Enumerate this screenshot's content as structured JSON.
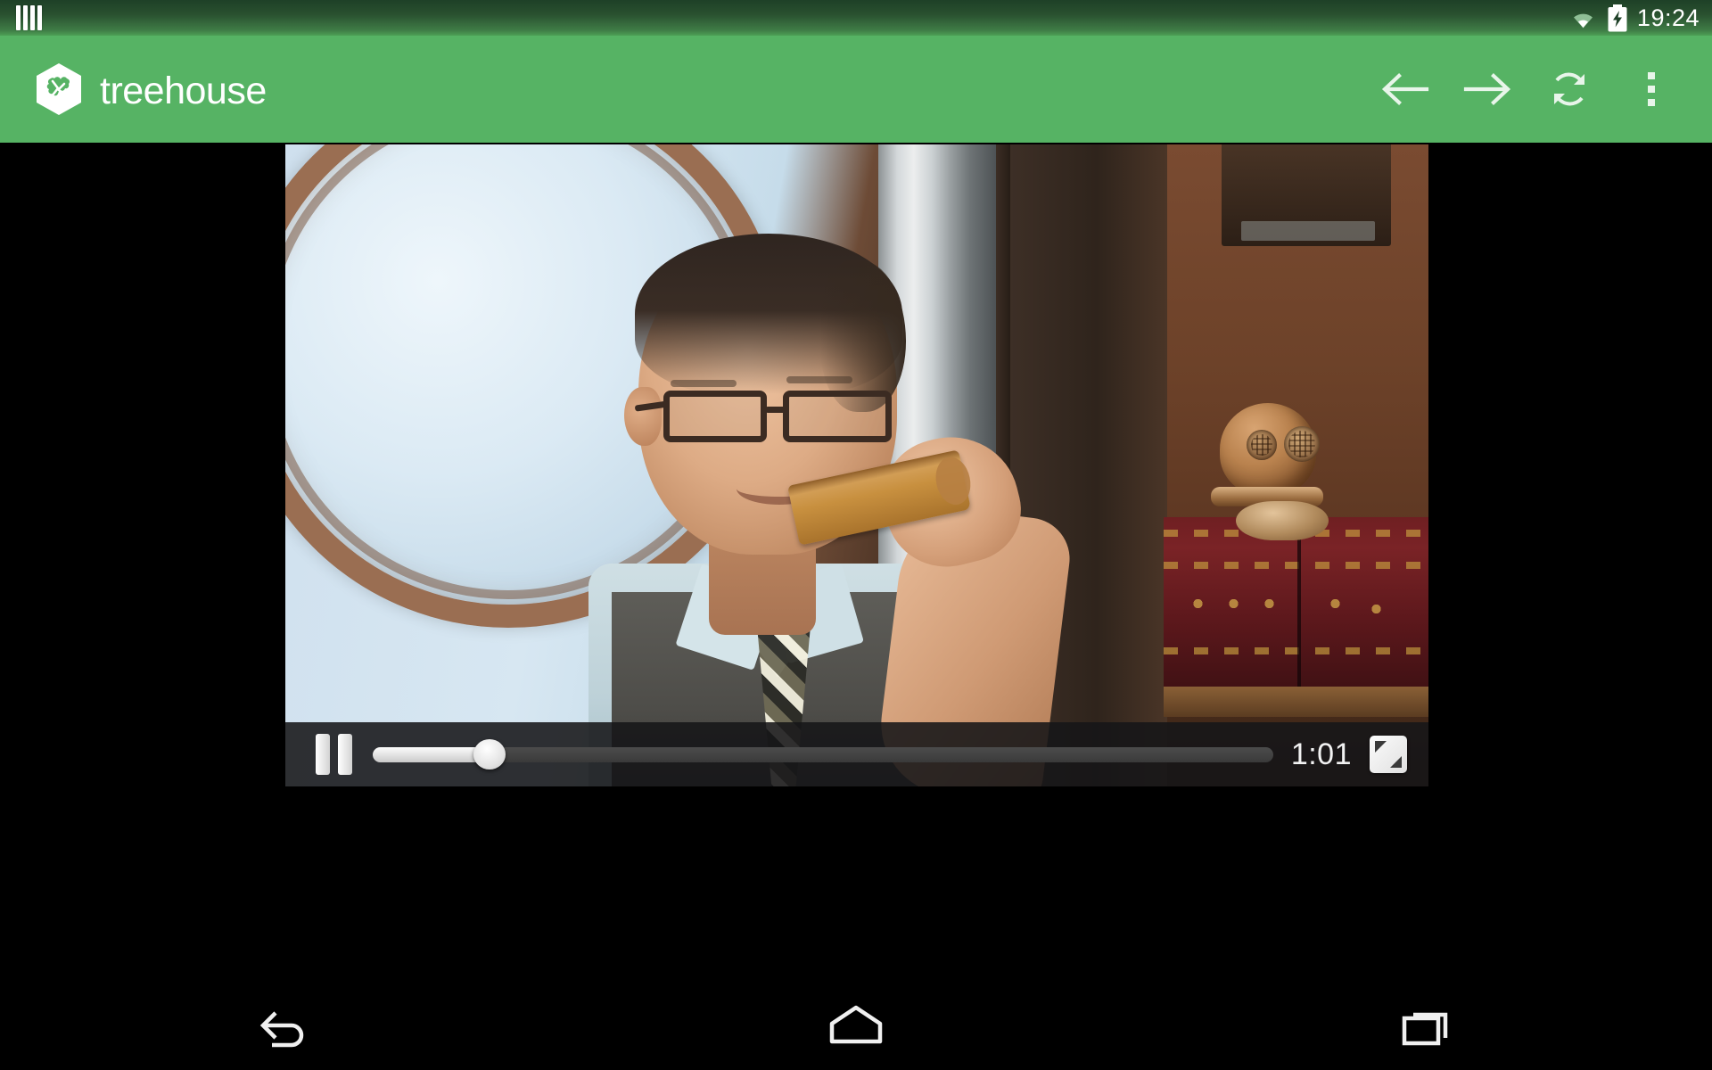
{
  "status_bar": {
    "left_icon": "signal-bars-icon",
    "wifi_icon": "wifi-icon",
    "battery_icon": "battery-charging-icon",
    "time": "19:24"
  },
  "app_bar": {
    "brand_name": "treehouse",
    "brand_logo": "treehouse-hexagon-logo",
    "background_color": "#56b364",
    "actions": [
      {
        "name": "back-arrow-icon",
        "label": "Back"
      },
      {
        "name": "forward-arrow-icon",
        "label": "Forward"
      },
      {
        "name": "refresh-icon",
        "label": "Refresh"
      },
      {
        "name": "overflow-menu-icon",
        "label": "More options"
      }
    ]
  },
  "video_player": {
    "state": "playing",
    "play_pause_icon": "pause-icon",
    "progress_percent": 13,
    "time_display": "1:01",
    "fullscreen_icon": "fullscreen-icon",
    "scene_description": "Man with dark-rimmed glasses in a gray vest, light blue shirt and checkered tie biting a slice of toast in front of a round porthole window"
  },
  "navigation_bar": [
    {
      "name": "android-back-icon",
      "label": "Back"
    },
    {
      "name": "android-home-icon",
      "label": "Home"
    },
    {
      "name": "android-recents-icon",
      "label": "Recent apps"
    }
  ]
}
